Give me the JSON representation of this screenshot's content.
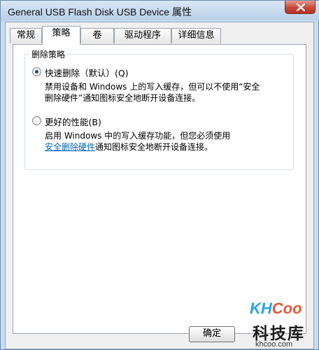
{
  "window": {
    "title": "General USB Flash Disk USB Device 属性"
  },
  "tabs": [
    {
      "label": "常规",
      "active": false
    },
    {
      "label": "策略",
      "active": true
    },
    {
      "label": "卷",
      "active": false
    },
    {
      "label": "驱动程序",
      "active": false
    },
    {
      "label": "详细信息",
      "active": false
    }
  ],
  "policy": {
    "group_title": "删除策略",
    "quick_removal": {
      "label": "快速删除（默认）(Q)",
      "selected": true,
      "desc_line1": "禁用设备和 Windows 上的写入缓存，但可以不使用“安全",
      "desc_line2": "删除硬件”通知图标安全地断开设备连接。"
    },
    "better_performance": {
      "label": "更好的性能(B)",
      "selected": false,
      "desc_line1": "启用 Windows 中的写入缓存功能，但您必须使用",
      "desc_link": "安全删除硬件",
      "desc_line2_rest": "通知图标安全地断开设备连接。"
    }
  },
  "buttons": {
    "ok": "确定"
  },
  "watermark": {
    "logo_k": "K",
    "logo_h": "H",
    "logo_c": "Coo",
    "cn": "科技库",
    "url": "khcoo.com"
  },
  "colors": {
    "link": "#0a66b5",
    "close_button": "#c9483b",
    "frame": "#c8dcef"
  }
}
